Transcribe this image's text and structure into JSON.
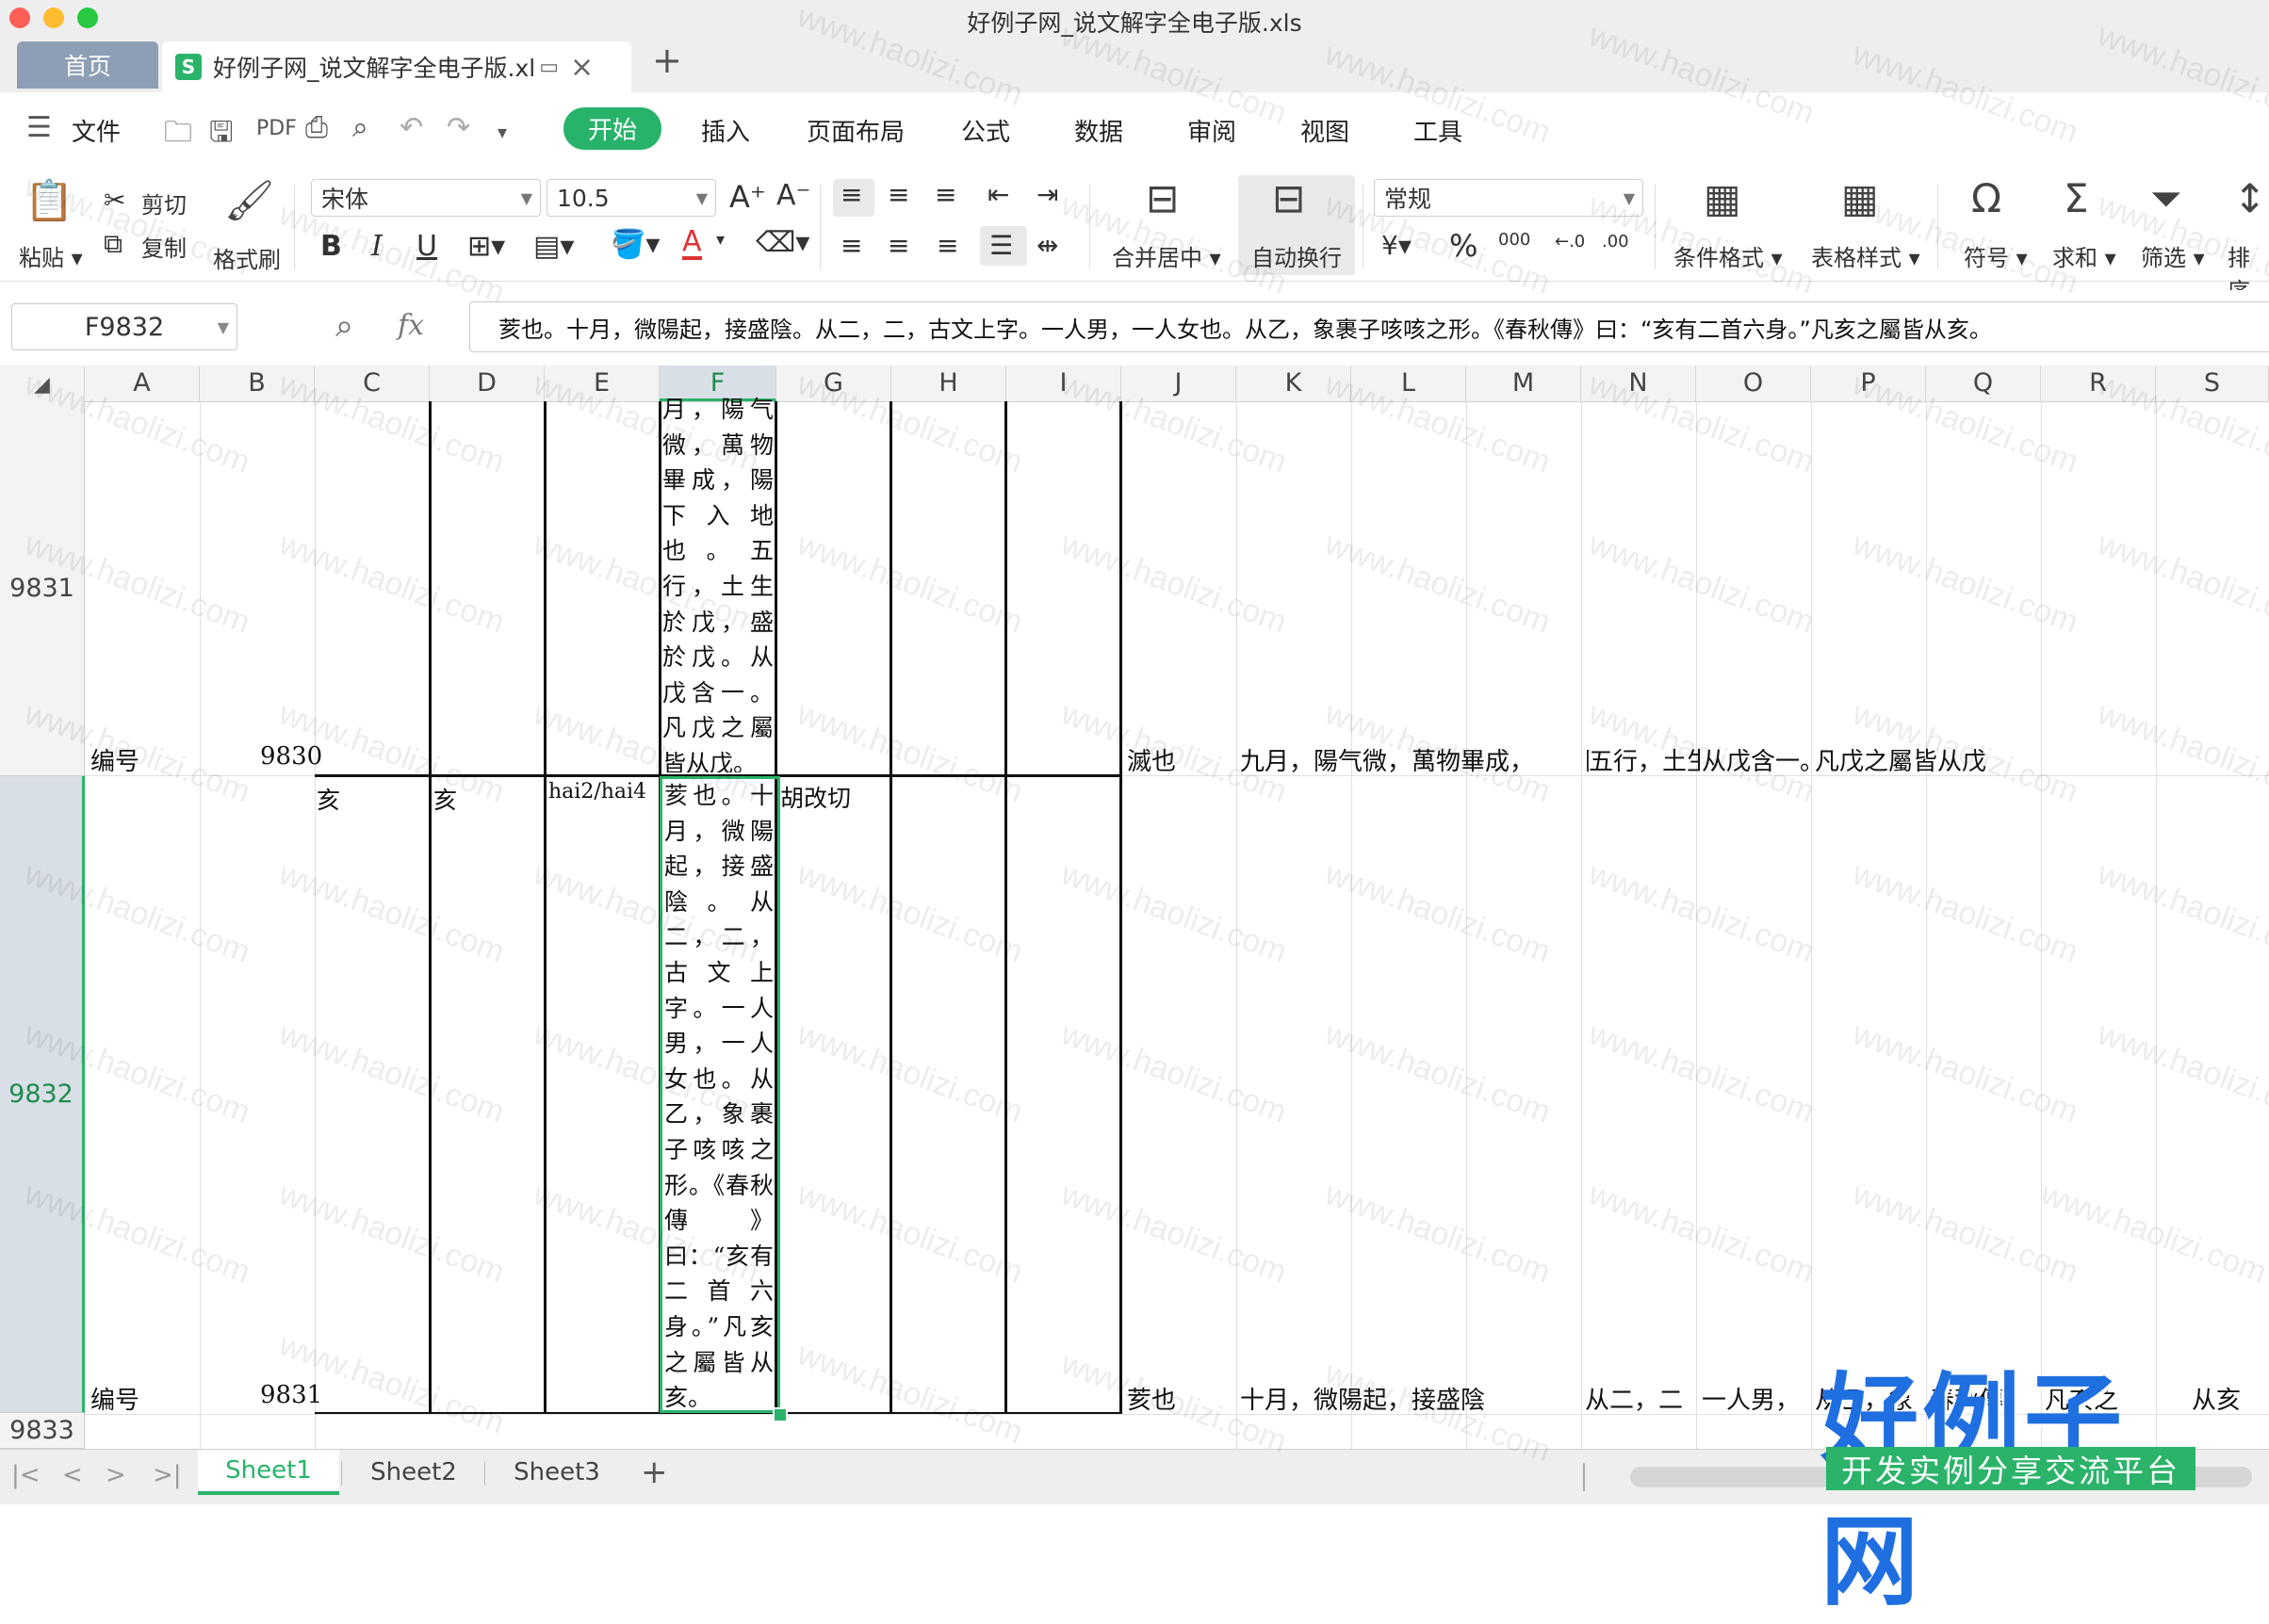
{
  "window": {
    "title": "好例子网_说文解字全电子版.xls"
  },
  "tabs": {
    "home": "首页",
    "document": "好例子网_说文解字全电子版.xl"
  },
  "menu": {
    "file": "文件",
    "items": [
      "开始",
      "插入",
      "页面布局",
      "公式",
      "数据",
      "审阅",
      "视图",
      "工具"
    ]
  },
  "ribbon": {
    "paste": "粘贴",
    "cut": "剪切",
    "copy": "复制",
    "format_painter": "格式刷",
    "font_name": "宋体",
    "font_size": "10.5",
    "bold": "B",
    "italic": "I",
    "underline": "U",
    "merge_center": "合并居中",
    "wrap_text": "自动换行",
    "number_format": "常规",
    "percent": "%",
    "thousands": "000",
    "conditional_format": "条件格式",
    "table_style": "表格样式",
    "symbol": "符号",
    "sum": "求和",
    "filter": "筛选",
    "sort": "排序"
  },
  "formula_bar": {
    "name_box": "F9832",
    "fx": "fx",
    "content": "荄也。十月，微陽起，接盛陰。从二，二，古文上字。一人男，一人女也。从乙，象裹子咳咳之形。《春秋傳》曰：“亥有二首六身。”凡亥之屬皆从亥。"
  },
  "columns": [
    "A",
    "B",
    "C",
    "D",
    "E",
    "F",
    "G",
    "H",
    "I",
    "J",
    "K",
    "L",
    "M",
    "N",
    "O",
    "P",
    "Q",
    "R",
    "S"
  ],
  "rows": {
    "r9831": "9831",
    "r9832": "9832",
    "r9833": "9833"
  },
  "cells": {
    "r9831": {
      "A": "编号",
      "B": "9830",
      "F": "月，陽气微，萬物畢成，陽下入地也。五行，土生於戊，盛於戊。从戊含一。凡戊之屬皆从戊。",
      "J": "滅也",
      "K": "九月，陽气微，萬物畢成，",
      "M_part": "陽下入地也。",
      "N": "五行，土生於戊，盛於戊。",
      "O": "从戊含一。",
      "P": "凡戊之屬皆从戊"
    },
    "r9832": {
      "A": "编号",
      "B": "9831",
      "C": "亥",
      "D": "亥",
      "E": "hai2/hai4",
      "F": "荄也。十月，微陽起，接盛陰。从二，二，古文上字。一人男，一人女也。从乙，象裹子咳咳之形。《春秋傳》曰：“亥有二首六身。”凡亥之屬皆从亥。",
      "G": "胡改切",
      "J": "荄也",
      "K": "十月，微陽起，接盛陰",
      "N": "从二，二",
      "O": "一人男，",
      "P": "从乙，象",
      "Q": "春秋傳",
      "R": "凡亥之",
      "S": "从亥"
    }
  },
  "sheets": [
    "Sheet1",
    "Sheet2",
    "Sheet3"
  ],
  "watermark": {
    "site": "www.haolizi.com",
    "logo_big": "好例子网",
    "logo_small": "开发实例分享交流平台"
  },
  "colors": {
    "accent": "#2bb36a",
    "logo_blue": "#1f6fe0"
  }
}
